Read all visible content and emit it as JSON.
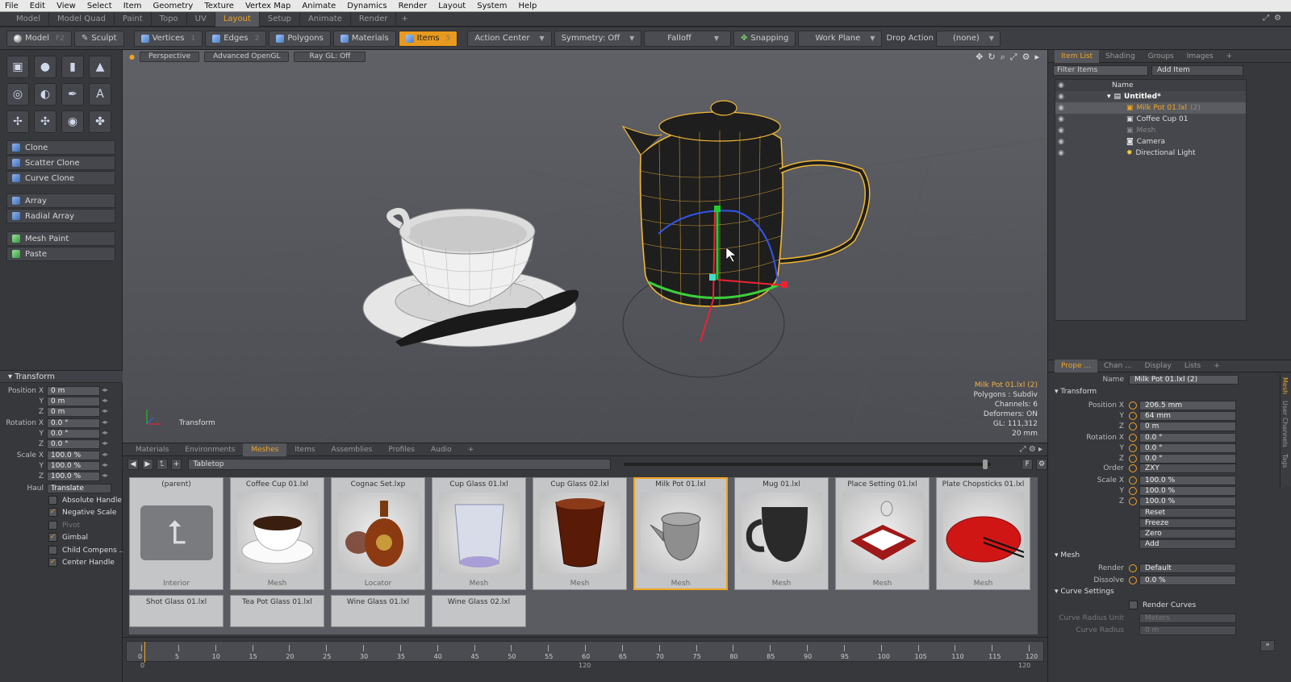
{
  "menu": [
    "File",
    "Edit",
    "View",
    "Select",
    "Item",
    "Geometry",
    "Texture",
    "Vertex Map",
    "Animate",
    "Dynamics",
    "Render",
    "Layout",
    "System",
    "Help"
  ],
  "layout_tabs": [
    "Model",
    "Model Quad",
    "Paint",
    "Topo",
    "UV",
    "Layout",
    "Setup",
    "Animate",
    "Render"
  ],
  "layout_tabs_plus": "+",
  "toolbar": {
    "model": "Model",
    "model_key": "F2",
    "sculpt": "Sculpt",
    "vertices": "Vertices",
    "vertices_key": "1",
    "edges": "Edges",
    "edges_key": "2",
    "polygons": "Polygons",
    "materials": "Materials",
    "items": "Items",
    "items_key": "5",
    "action_center": "Action Center",
    "symmetry": "Symmetry: Off",
    "falloff": "Falloff",
    "snapping": "Snapping",
    "work_plane": "Work Plane",
    "drop_action": "Drop Action",
    "drop_value": "(none)"
  },
  "tools": [
    "Clone",
    "Scatter Clone",
    "Curve Clone",
    "Array",
    "Radial Array",
    "Mesh Paint",
    "Paste"
  ],
  "transform": {
    "title": "Transform",
    "pos_label": "Position X",
    "pos": [
      "0 m",
      "0 m",
      "0 m"
    ],
    "rot_label": "Rotation X",
    "rot": [
      "0.0 °",
      "0.0 °",
      "0.0 °"
    ],
    "scale_label": "Scale X",
    "scale": [
      "100.0 %",
      "100.0 %",
      "100.0 %"
    ],
    "y": "Y",
    "z": "Z",
    "haul_label": "Haul",
    "haul": "Translate",
    "options": [
      {
        "label": "Absolute Handle",
        "checked": ""
      },
      {
        "label": "Negative Scale",
        "checked": "✓"
      },
      {
        "label": "Pivot",
        "checked": ""
      },
      {
        "label": "Gimbal",
        "checked": "✓"
      },
      {
        "label": "Child Compens ...",
        "checked": ""
      },
      {
        "label": "Center Handle",
        "checked": "✓"
      }
    ]
  },
  "viewport": {
    "view": "Perspective",
    "shading": "Advanced OpenGL",
    "raygl": "Ray GL: Off",
    "info": [
      "Milk Pot 01.lxl (2)",
      "Polygons : Subdiv",
      "Channels: 6",
      "Deformers: ON",
      "GL: 111,312",
      "20 mm"
    ],
    "tool": "Transform"
  },
  "preset_tabs": [
    "Materials",
    "Environments",
    "Meshes",
    "Items",
    "Assemblies",
    "Profiles",
    "Audio"
  ],
  "preset_tabs_plus": "+",
  "preset_path": "Tabletop",
  "presets": [
    {
      "name": "(parent)",
      "type": "Interior"
    },
    {
      "name": "Coffee Cup 01.lxl",
      "type": "Mesh"
    },
    {
      "name": "Cognac Set.lxp",
      "type": "Locator"
    },
    {
      "name": "Cup Glass 01.lxl",
      "type": "Mesh"
    },
    {
      "name": "Cup Glass 02.lxl",
      "type": "Mesh"
    },
    {
      "name": "Milk Pot 01.lxl",
      "type": "Mesh"
    },
    {
      "name": "Mug 01.lxl",
      "type": "Mesh"
    },
    {
      "name": "Place Setting 01.lxl",
      "type": "Mesh"
    },
    {
      "name": "Plate Chopsticks 01.lxl",
      "type": "Mesh"
    }
  ],
  "presets_row2": [
    "Shot Glass 01.lxl",
    "Tea Pot Glass 01.lxl",
    "Wine Glass 01.lxl",
    "Wine Glass 02.lxl"
  ],
  "timeline": {
    "ticks": [
      "0",
      "5",
      "10",
      "15",
      "20",
      "25",
      "30",
      "35",
      "40",
      "45",
      "50",
      "55",
      "60",
      "65",
      "70",
      "75",
      "80",
      "85",
      "90",
      "95",
      "100",
      "105",
      "110",
      "115",
      "120"
    ],
    "start": "0",
    "mid": "120",
    "end": "120"
  },
  "right_tabs": [
    "Item List",
    "Shading",
    "Groups",
    "Images"
  ],
  "right_tabs_plus": "+",
  "filter_placeholder": "Filter Items",
  "add_item": "Add Item",
  "name_col": "Name",
  "items": [
    {
      "name": "Untitled*",
      "bold": true
    },
    {
      "name": "Milk Pot 01.lxl",
      "suffix": "(2)"
    },
    {
      "name": "Coffee Cup 01"
    },
    {
      "name": "Mesh"
    },
    {
      "name": "Camera"
    },
    {
      "name": "Directional Light"
    }
  ],
  "prop_tabs": [
    "Prope ...",
    "Chan ...",
    "Display",
    "Lists"
  ],
  "prop_tabs_plus": "+",
  "props": {
    "name_label": "Name",
    "name": "Milk Pot 01.lxl (2)",
    "transform": "Transform",
    "pos_label": "Position X",
    "pos": [
      "206.5 mm",
      "64 mm",
      "0 m"
    ],
    "rot_label": "Rotation X",
    "rot": [
      "0.0 °",
      "0.0 °",
      "0.0 °"
    ],
    "order_label": "Order",
    "order": "ZXY",
    "scale_label": "Scale X",
    "scale": [
      "100.0 %",
      "100.0 %",
      "100.0 %"
    ],
    "y": "Y",
    "z": "Z",
    "actions": [
      "Reset",
      "Freeze",
      "Zero",
      "Add"
    ],
    "mesh": "Mesh",
    "render_label": "Render",
    "render": "Default",
    "dissolve_label": "Dissolve",
    "dissolve": "0.0 %",
    "curve": "Curve Settings",
    "render_curves": "Render Curves",
    "crunit_label": "Curve Radius Unit",
    "crunit": "Meters",
    "cr_label": "Curve Radius",
    "cr": "0 m"
  },
  "side_tabs": [
    "Mesh",
    "User Channels",
    "Tags"
  ]
}
